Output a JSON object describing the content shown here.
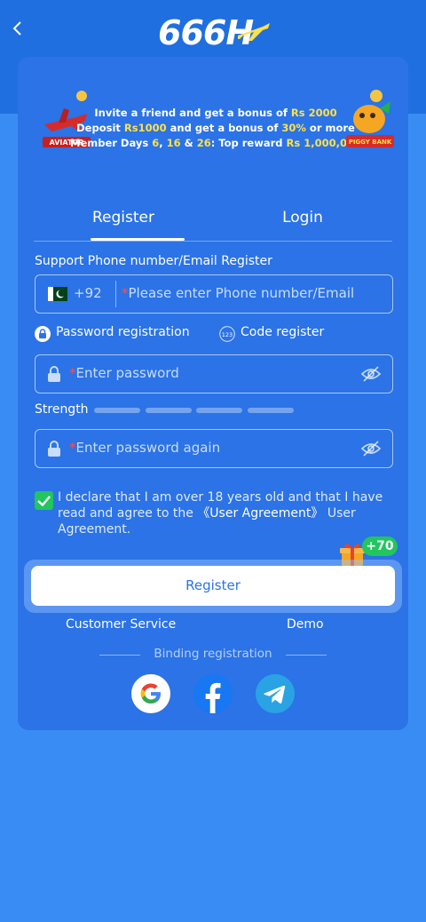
{
  "header": {
    "logo_text": "666",
    "logo_letter": "H"
  },
  "banner": {
    "line1_prefix": "Invite a friend and get a bonus of ",
    "line1_amount": "Rs 2000",
    "line2_prefix": "Deposit ",
    "line2_deposit": "Rs1000",
    "line2_mid": " and get a bonus of ",
    "line2_percent": "30%",
    "line2_suffix": " or more",
    "line3_prefix": "Member Days ",
    "line3_d1": "6",
    "line3_c1": ", ",
    "line3_d2": "16",
    "line3_c2": " & ",
    "line3_d3": "26",
    "line3_mid": ": Top reward ",
    "line3_reward": "Rs 1,000,000",
    "aviator_label": "AVIATOR",
    "piggy_label": "PIGGY BANK"
  },
  "tabs": {
    "register": "Register",
    "login": "Login"
  },
  "form": {
    "section_label": "Support Phone number/Email Register",
    "country_code": "+92",
    "required_mark": "*",
    "phone_placeholder": "Please enter Phone number/Email",
    "mode_password": "Password registration",
    "mode_code": "Code register",
    "mode_code_icon_text": "123",
    "password_placeholder": "Enter password",
    "strength_label": "Strength",
    "password_again_placeholder": "Enter password again"
  },
  "agreement": {
    "text_start": "I declare that I am over 18 years old and that I have read and agree to the ",
    "link": "《User Agreement》",
    "text_end": " User Agreement.",
    "checked": true
  },
  "bonus_badge": "+70",
  "register_button": "Register",
  "links": {
    "customer_service": "Customer Service",
    "demo": "Demo"
  },
  "binding_label": "Binding registration",
  "social": [
    "google-icon",
    "facebook-icon",
    "telegram-icon"
  ],
  "colors": {
    "background": "#3a8cf5",
    "card": "#2b73e6",
    "highlight": "#ffe14a",
    "success": "#22c55e",
    "required": "#ff4d4d"
  }
}
